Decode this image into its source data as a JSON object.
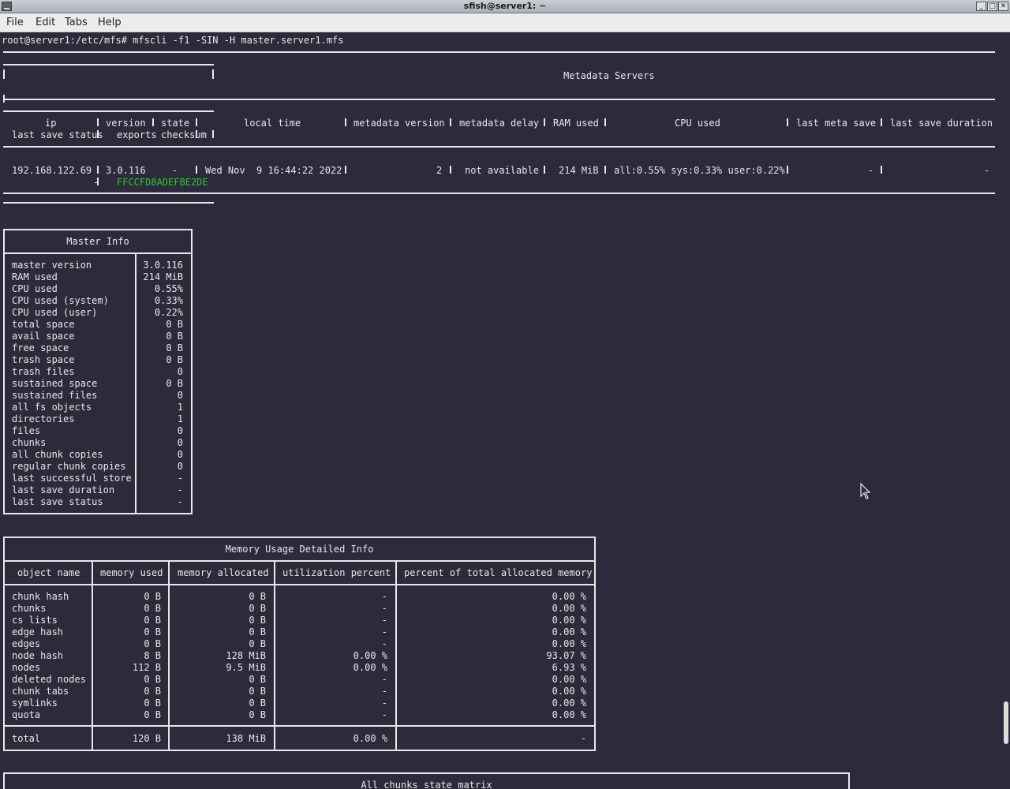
{
  "window": {
    "title": "sfish@server1: ~"
  },
  "menu": {
    "file": "File",
    "edit": "Edit",
    "tabs": "Tabs",
    "help": "Help"
  },
  "prompt": "root@server1:/etc/mfs# mfscli -f1 -SIN -H master.server1.mfs",
  "metadata_servers": {
    "title": "Metadata Servers",
    "headers_top": [
      "ip",
      "version",
      "state",
      "local time",
      "metadata version",
      "metadata delay",
      "RAM used",
      "CPU used",
      "last meta save",
      "last save duration"
    ],
    "headers_bottom": [
      "last save status",
      "exports",
      "checksum"
    ],
    "row": {
      "ip": "192.168.122.69",
      "version": "3.0.116",
      "state": "-",
      "local_time": "Wed Nov  9 16:44:22 2022",
      "metadata_version": "2",
      "metadata_delay": "not available",
      "ram_used": "214 MiB",
      "cpu_used": "all:0.55% sys:0.33% user:0.22%",
      "last_meta_save": "-",
      "last_save_duration": "-",
      "last_save_status": "-",
      "checksum": "FFCCFD8ADEFBE2DE"
    }
  },
  "master_info": {
    "title": "Master Info",
    "rows": [
      {
        "label": "master version",
        "value": "3.0.116"
      },
      {
        "label": "RAM used",
        "value": "214 MiB"
      },
      {
        "label": "CPU used",
        "value": "0.55%"
      },
      {
        "label": "CPU used (system)",
        "value": "0.33%"
      },
      {
        "label": "CPU used (user)",
        "value": "0.22%"
      },
      {
        "label": "total space",
        "value": "0 B"
      },
      {
        "label": "avail space",
        "value": "0 B"
      },
      {
        "label": "free space",
        "value": "0 B"
      },
      {
        "label": "trash space",
        "value": "0 B"
      },
      {
        "label": "trash files",
        "value": "0"
      },
      {
        "label": "sustained space",
        "value": "0 B"
      },
      {
        "label": "sustained files",
        "value": "0"
      },
      {
        "label": "all fs objects",
        "value": "1"
      },
      {
        "label": "directories",
        "value": "1"
      },
      {
        "label": "files",
        "value": "0"
      },
      {
        "label": "chunks",
        "value": "0"
      },
      {
        "label": "all chunk copies",
        "value": "0"
      },
      {
        "label": "regular chunk copies",
        "value": "0"
      },
      {
        "label": "last successful store",
        "value": "-"
      },
      {
        "label": "last save duration",
        "value": "-"
      },
      {
        "label": "last save status",
        "value": "-"
      }
    ]
  },
  "memory_usage": {
    "title": "Memory Usage Detailed Info",
    "headers": [
      "object name",
      "memory used",
      "memory allocated",
      "utilization percent",
      "percent of total allocated memory"
    ],
    "rows": [
      [
        "chunk hash",
        "0 B",
        "0 B",
        "-",
        "0.00 %"
      ],
      [
        "chunks",
        "0 B",
        "0 B",
        "-",
        "0.00 %"
      ],
      [
        "cs lists",
        "0 B",
        "0 B",
        "-",
        "0.00 %"
      ],
      [
        "edge hash",
        "0 B",
        "0 B",
        "-",
        "0.00 %"
      ],
      [
        "edges",
        "0 B",
        "0 B",
        "-",
        "0.00 %"
      ],
      [
        "node hash",
        "8 B",
        "128 MiB",
        "0.00 %",
        "93.07 %"
      ],
      [
        "nodes",
        "112 B",
        "9.5 MiB",
        "0.00 %",
        "6.93 %"
      ],
      [
        "deleted nodes",
        "0 B",
        "0 B",
        "-",
        "0.00 %"
      ],
      [
        "chunk tabs",
        "0 B",
        "0 B",
        "-",
        "0.00 %"
      ],
      [
        "symlinks",
        "0 B",
        "0 B",
        "-",
        "0.00 %"
      ],
      [
        "quota",
        "0 B",
        "0 B",
        "-",
        "0.00 %"
      ]
    ],
    "total": [
      "total",
      "120 B",
      "138 MiB",
      "0.00 %",
      "-"
    ]
  },
  "chunks_matrix": {
    "title": "All chunks state matrix"
  }
}
